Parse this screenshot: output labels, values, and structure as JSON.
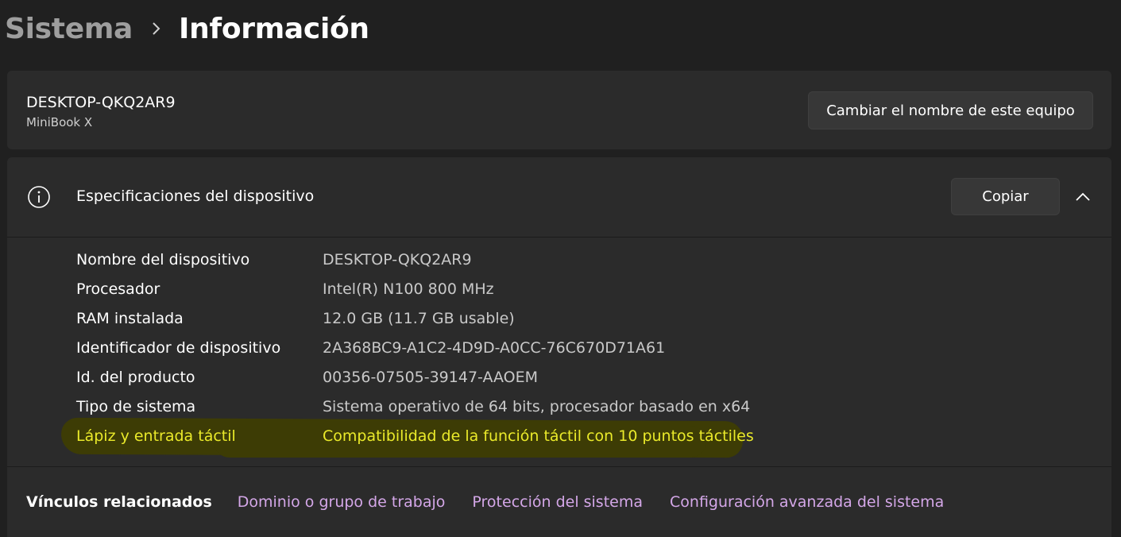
{
  "breadcrumb": {
    "parent": "Sistema",
    "current": "Información"
  },
  "device": {
    "name": "DESKTOP-QKQ2AR9",
    "model": "MiniBook X",
    "rename_label": "Cambiar el nombre de este equipo"
  },
  "specs": {
    "title": "Especificaciones del dispositivo",
    "copy_label": "Copiar",
    "rows": [
      {
        "label": "Nombre del dispositivo",
        "value": "DESKTOP-QKQ2AR9"
      },
      {
        "label": "Procesador",
        "value": "Intel(R) N100   800 MHz"
      },
      {
        "label": "RAM instalada",
        "value": "12.0 GB (11.7 GB usable)"
      },
      {
        "label": "Identificador de dispositivo",
        "value": "2A368BC9-A1C2-4D9D-A0CC-76C670D71A61"
      },
      {
        "label": "Id. del producto",
        "value": "00356-07505-39147-AAOEM"
      },
      {
        "label": "Tipo de sistema",
        "value": "Sistema operativo de 64 bits, procesador basado en x64"
      },
      {
        "label": "Lápiz y entrada táctil",
        "value": "Compatibilidad de la función táctil con 10 puntos táctiles"
      }
    ]
  },
  "related": {
    "title": "Vínculos relacionados",
    "links": [
      "Dominio o grupo de trabajo",
      "Protección del sistema",
      "Configuración avanzada del sistema"
    ]
  },
  "colors": {
    "background": "#202020",
    "card": "#2b2b2b",
    "link": "#d4a7e8",
    "highlight_text": "#eaea2a",
    "highlight_marker": "#3d3c05"
  }
}
